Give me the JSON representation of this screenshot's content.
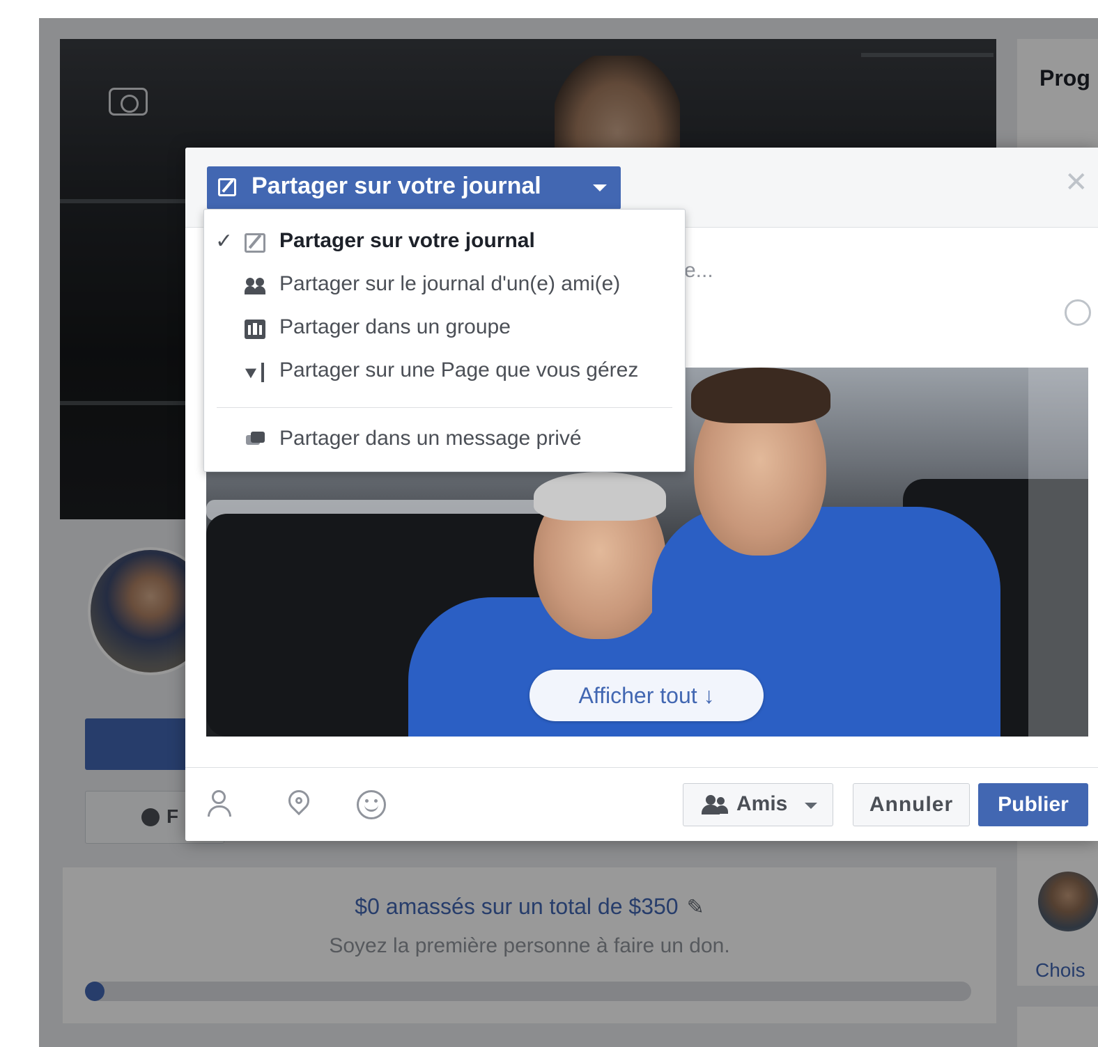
{
  "background_page": {
    "fundraiser": {
      "raised_text": "$0 amassés sur un total de $350",
      "subtitle": "Soyez la première personne à faire un don.",
      "progress_fraction": 0
    },
    "button_partial_letter": "F",
    "sidebar_title": "Prog",
    "sidebar_link": "Chois"
  },
  "dialog": {
    "share_target_label": "Partager sur votre journal",
    "close_icon": "close-icon",
    "composer_placeholder_fragment": "e...",
    "show_all_label": "Afficher tout ↓",
    "footer": {
      "audience_label": "Amis",
      "cancel_label": "Annuler",
      "publish_label": "Publier"
    }
  },
  "share_menu": {
    "items": [
      {
        "label": "Partager sur votre journal",
        "icon": "edit-icon",
        "selected": true
      },
      {
        "label": "Partager sur le journal d'un(e) ami(e)",
        "icon": "friends-icon",
        "selected": false
      },
      {
        "label": "Partager dans un groupe",
        "icon": "group-icon",
        "selected": false
      },
      {
        "label": "Partager sur une Page que vous gérez",
        "icon": "flag-icon",
        "selected": false
      },
      {
        "label": "Partager dans un message privé",
        "icon": "message-icon",
        "selected": false
      }
    ],
    "check_glyph": "✓"
  },
  "colors": {
    "brand_blue": "#4267b2",
    "text_dark": "#1d2129",
    "text_grey": "#90949c"
  }
}
